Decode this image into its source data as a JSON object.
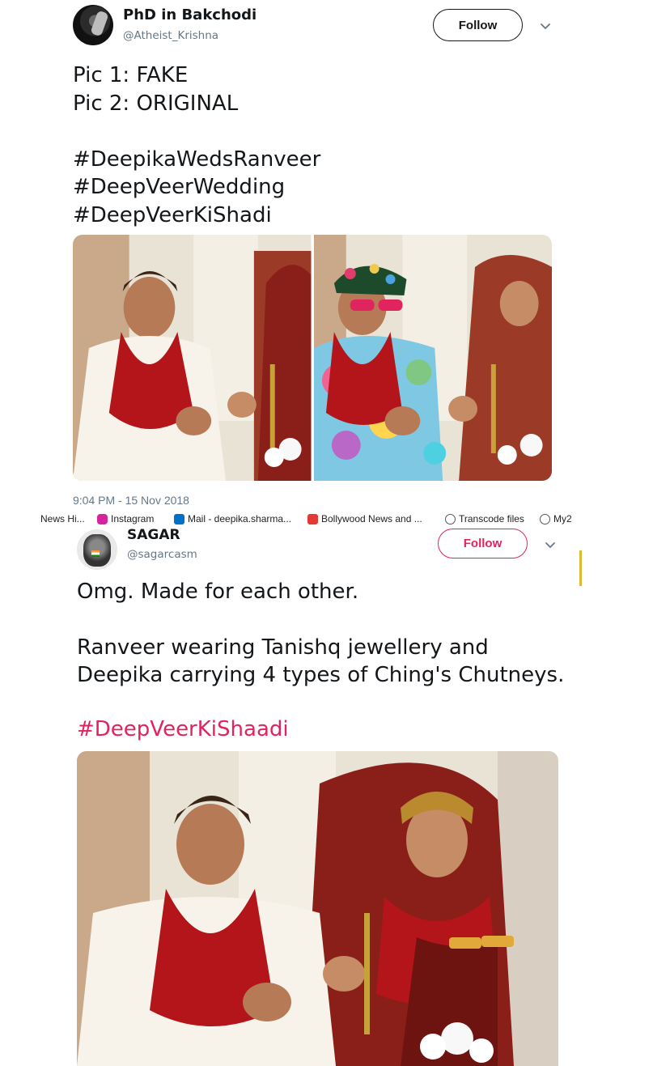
{
  "tweet1": {
    "display_name": "PhD in Bakchodi",
    "handle": "@Atheist_Krishna",
    "follow_label": "Follow",
    "text_lines": [
      "Pic 1: FAKE",
      "Pic 2: ORIGINAL",
      "",
      "#DeepikaWedsRanveer",
      "#DeepVeerWedding",
      "#DeepVeerKiShadi"
    ],
    "timestamp": "9:04 PM - 15 Nov 2018",
    "media_icons": [
      "wedding-photo-original",
      "wedding-photo-edited"
    ]
  },
  "bookmarks": [
    {
      "label": "News Hi...",
      "icon": "news-icon",
      "color": "#999999"
    },
    {
      "label": "Instagram",
      "icon": "instagram-icon",
      "color": "#d6249f"
    },
    {
      "label": "Mail - deepika.sharma...",
      "icon": "mail-icon",
      "color": "#0072c6"
    },
    {
      "label": "Bollywood News and ...",
      "icon": "bollywood-icon",
      "color": "#e53935"
    },
    {
      "label": "Transcode files",
      "icon": "globe-icon",
      "color": "#555555"
    },
    {
      "label": "My2",
      "icon": "globe-icon",
      "color": "#555555"
    }
  ],
  "tweet2": {
    "display_name": "SAGAR",
    "handle": "@sagarcasm",
    "follow_label": "Follow",
    "line1": "Omg. Made for each other.",
    "line2": "Ranveer wearing Tanishq jewellery and",
    "line3": "Deepika carrying 4 types of Ching's Chutneys.",
    "hashtag": "#DeepVeerKiShaadi",
    "accent_color": "#e0245e"
  }
}
